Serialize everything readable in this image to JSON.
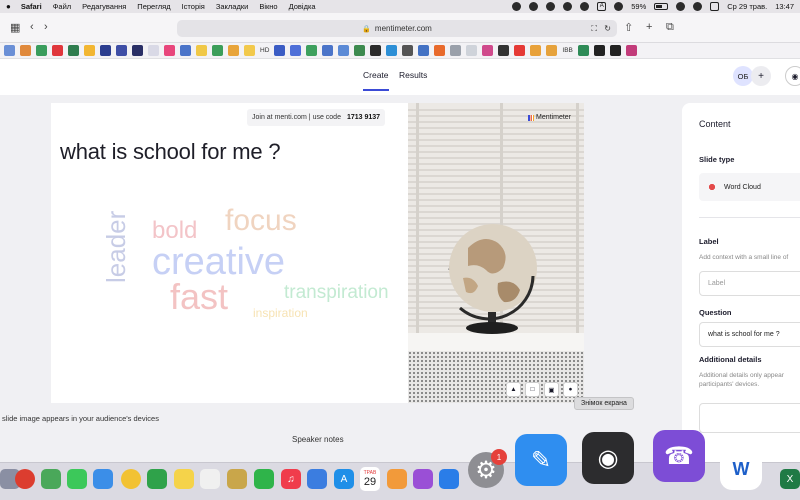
{
  "menubar": {
    "app": "Safari",
    "items": [
      "Файл",
      "Редагування",
      "Перегляд",
      "Історія",
      "Закладки",
      "Вікно",
      "Довідка"
    ],
    "battery_percent": "59%",
    "battery_level": 0.59,
    "date": "Ср 29 трав.",
    "time": "13:47"
  },
  "browser": {
    "url": "mentimeter.com"
  },
  "bookmarks": {
    "text_items": [
      "HD",
      "IBB"
    ]
  },
  "app_header": {
    "tab_create": "Create",
    "tab_results": "Results",
    "avatar_initials": "ОБ",
    "add_symbol": "+"
  },
  "slide": {
    "join_text": "Join at menti.com | use code",
    "join_code": "1713 9137",
    "brand": "Mentimeter",
    "question": "what is school for me ?",
    "word_cloud": [
      {
        "word": "leader",
        "color": "#c7cce6"
      },
      {
        "word": "bold",
        "color": "#f3c4c8"
      },
      {
        "word": "focus",
        "color": "#f0d4c0"
      },
      {
        "word": "creative",
        "color": "#c6d0f5"
      },
      {
        "word": "fast",
        "color": "#f3c3c3"
      },
      {
        "word": "transpiration",
        "color": "#c3ead2"
      },
      {
        "word": "inspiration",
        "color": "#f7e3b4"
      }
    ]
  },
  "caption": "slide image appears in your audience's devices",
  "speaker_notes": "Speaker notes",
  "tooltip": "Знімок екрана",
  "panel": {
    "title": "Content",
    "slide_type_label": "Slide type",
    "slide_type_value": "Word Cloud",
    "label_heading": "Label",
    "label_hint": "Add context with a small line of",
    "label_placeholder": "Label",
    "question_heading": "Question",
    "question_value": "what is school for me ?",
    "details_heading": "Additional details",
    "details_hint_1": "Additional details only appear",
    "details_hint_2": "participants' devices."
  },
  "dock": {
    "badge_count": "1",
    "calendar_month": "ТРАВ",
    "calendar_day": "29"
  }
}
